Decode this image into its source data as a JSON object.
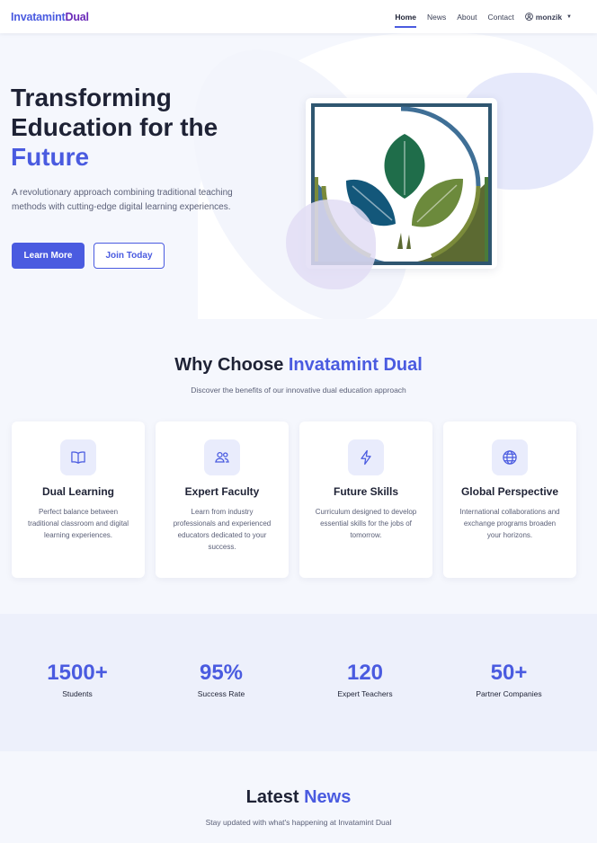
{
  "navbar": {
    "brand_part1": "Invatamint",
    "brand_part2": "Dual",
    "links": [
      "Home",
      "News",
      "About",
      "Contact"
    ],
    "user": "monzik"
  },
  "hero": {
    "title_line1": "Transforming",
    "title_line2": "Education for the",
    "title_accent": "Future",
    "lead": "A revolutionary approach combining traditional teaching methods with cutting-edge digital learning experiences.",
    "btn_primary": "Learn More",
    "btn_secondary": "Join Today"
  },
  "why": {
    "title": "Why Choose ",
    "title_accent": "Invatamint Dual",
    "subtitle": "Discover the benefits of our innovative dual education approach",
    "cards": [
      {
        "icon": "book-icon",
        "title": "Dual Learning",
        "text": "Perfect balance between traditional classroom and digital learning experiences."
      },
      {
        "icon": "users-icon",
        "title": "Expert Faculty",
        "text": "Learn from industry professionals and experienced educators dedicated to your success."
      },
      {
        "icon": "lightning-icon",
        "title": "Future Skills",
        "text": "Curriculum designed to develop essential skills for the jobs of tomorrow."
      },
      {
        "icon": "globe-icon",
        "title": "Global Perspective",
        "text": "International collaborations and exchange programs broaden your horizons."
      }
    ]
  },
  "stats": [
    {
      "value": "1500+",
      "label": "Students"
    },
    {
      "value": "95%",
      "label": "Success Rate"
    },
    {
      "value": "120",
      "label": "Expert Teachers"
    },
    {
      "value": "50+",
      "label": "Partner Companies"
    }
  ],
  "news": {
    "title": "Latest ",
    "title_accent": "News",
    "subtitle": "Stay updated with what's happening at Invatamint Dual"
  },
  "colors": {
    "accent": "#4a5be0",
    "brand_secondary": "#6a2ab8",
    "text_dark": "#1e2235"
  }
}
